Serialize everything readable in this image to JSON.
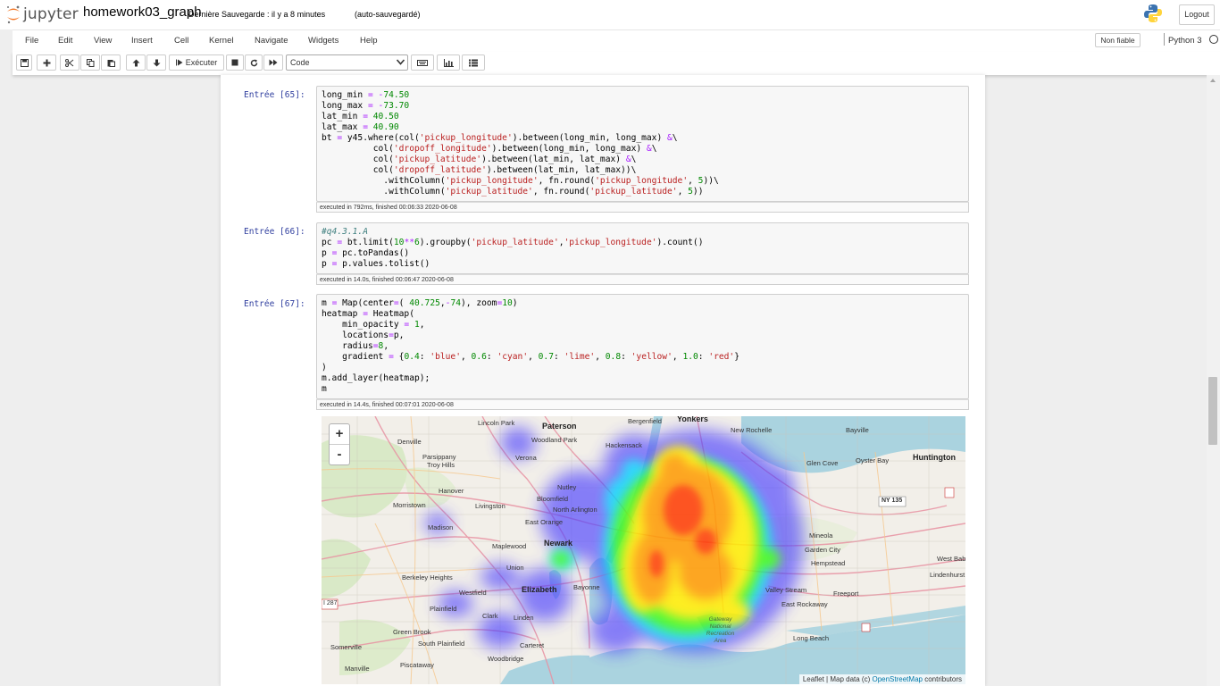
{
  "header": {
    "logo_text": "jupyter",
    "notebook_name": "homework03_graph",
    "checkpoint": "Dernière Sauvegarde : il y a 8 minutes",
    "autosave": "(auto-sauvegardé)",
    "logout": "Logout"
  },
  "menu": {
    "items": [
      "File",
      "Edit",
      "View",
      "Insert",
      "Cell",
      "Kernel",
      "Navigate",
      "Widgets",
      "Help"
    ],
    "trust": "Non fiable",
    "kernel": "Python 3"
  },
  "toolbar": {
    "run_label": "Exécuter",
    "cell_type": "Code"
  },
  "cells": [
    {
      "prompt": "Entrée [65]:",
      "exec_info": "executed in 792ms, finished 00:06:33 2020-06-08"
    },
    {
      "prompt": "Entrée [66]:",
      "exec_info": "executed in 14.0s, finished 00:06:47 2020-06-08"
    },
    {
      "prompt": "Entrée [67]:",
      "exec_info": "executed in 14.4s, finished 00:07:01 2020-06-08"
    }
  ],
  "map": {
    "zoom_in": "+",
    "zoom_out": "-",
    "attribution_prefix": "Leaflet | Map data (c) ",
    "attribution_link": "OpenStreetMap",
    "attribution_suffix": " contributors",
    "labels": [
      "Lincoln Park",
      "Paterson",
      "Bergenfield",
      "Yonkers",
      "New Rochelle",
      "Bayville",
      "Huntington",
      "Woodland Park",
      "Hackensack",
      "Denville",
      "Parsippany",
      "Troy Hills",
      "Glen Cove",
      "Oyster Bay",
      "Verona",
      "Nutley",
      "Hanover",
      "Livingston",
      "Morristown",
      "Bloomfield",
      "North Arlington",
      "NY 135",
      "East Orange",
      "Madison",
      "Mineola",
      "Maplewood",
      "Newark",
      "Garden City",
      "Hempstead",
      "West Bab",
      "Union",
      "Berkeley Heights",
      "Lindenhurst",
      "Elizabeth",
      "Bayonne",
      "Valley Stream",
      "Freeport",
      "Westfield",
      "East Rockaway",
      "Plainfield",
      "Clark",
      "Linden",
      "Gateway National Recreation Area",
      "Green Brook",
      "Long Beach",
      "South Plainfield",
      "Carteret",
      "Somerville",
      "Woodbridge",
      "Manville",
      "Piscataway",
      "I 287"
    ],
    "colors": {
      "blue": "#3a3aff",
      "cyan": "#00ffff",
      "lime": "#00ff00",
      "yellow": "#ffff00",
      "red": "#ff0000"
    }
  }
}
